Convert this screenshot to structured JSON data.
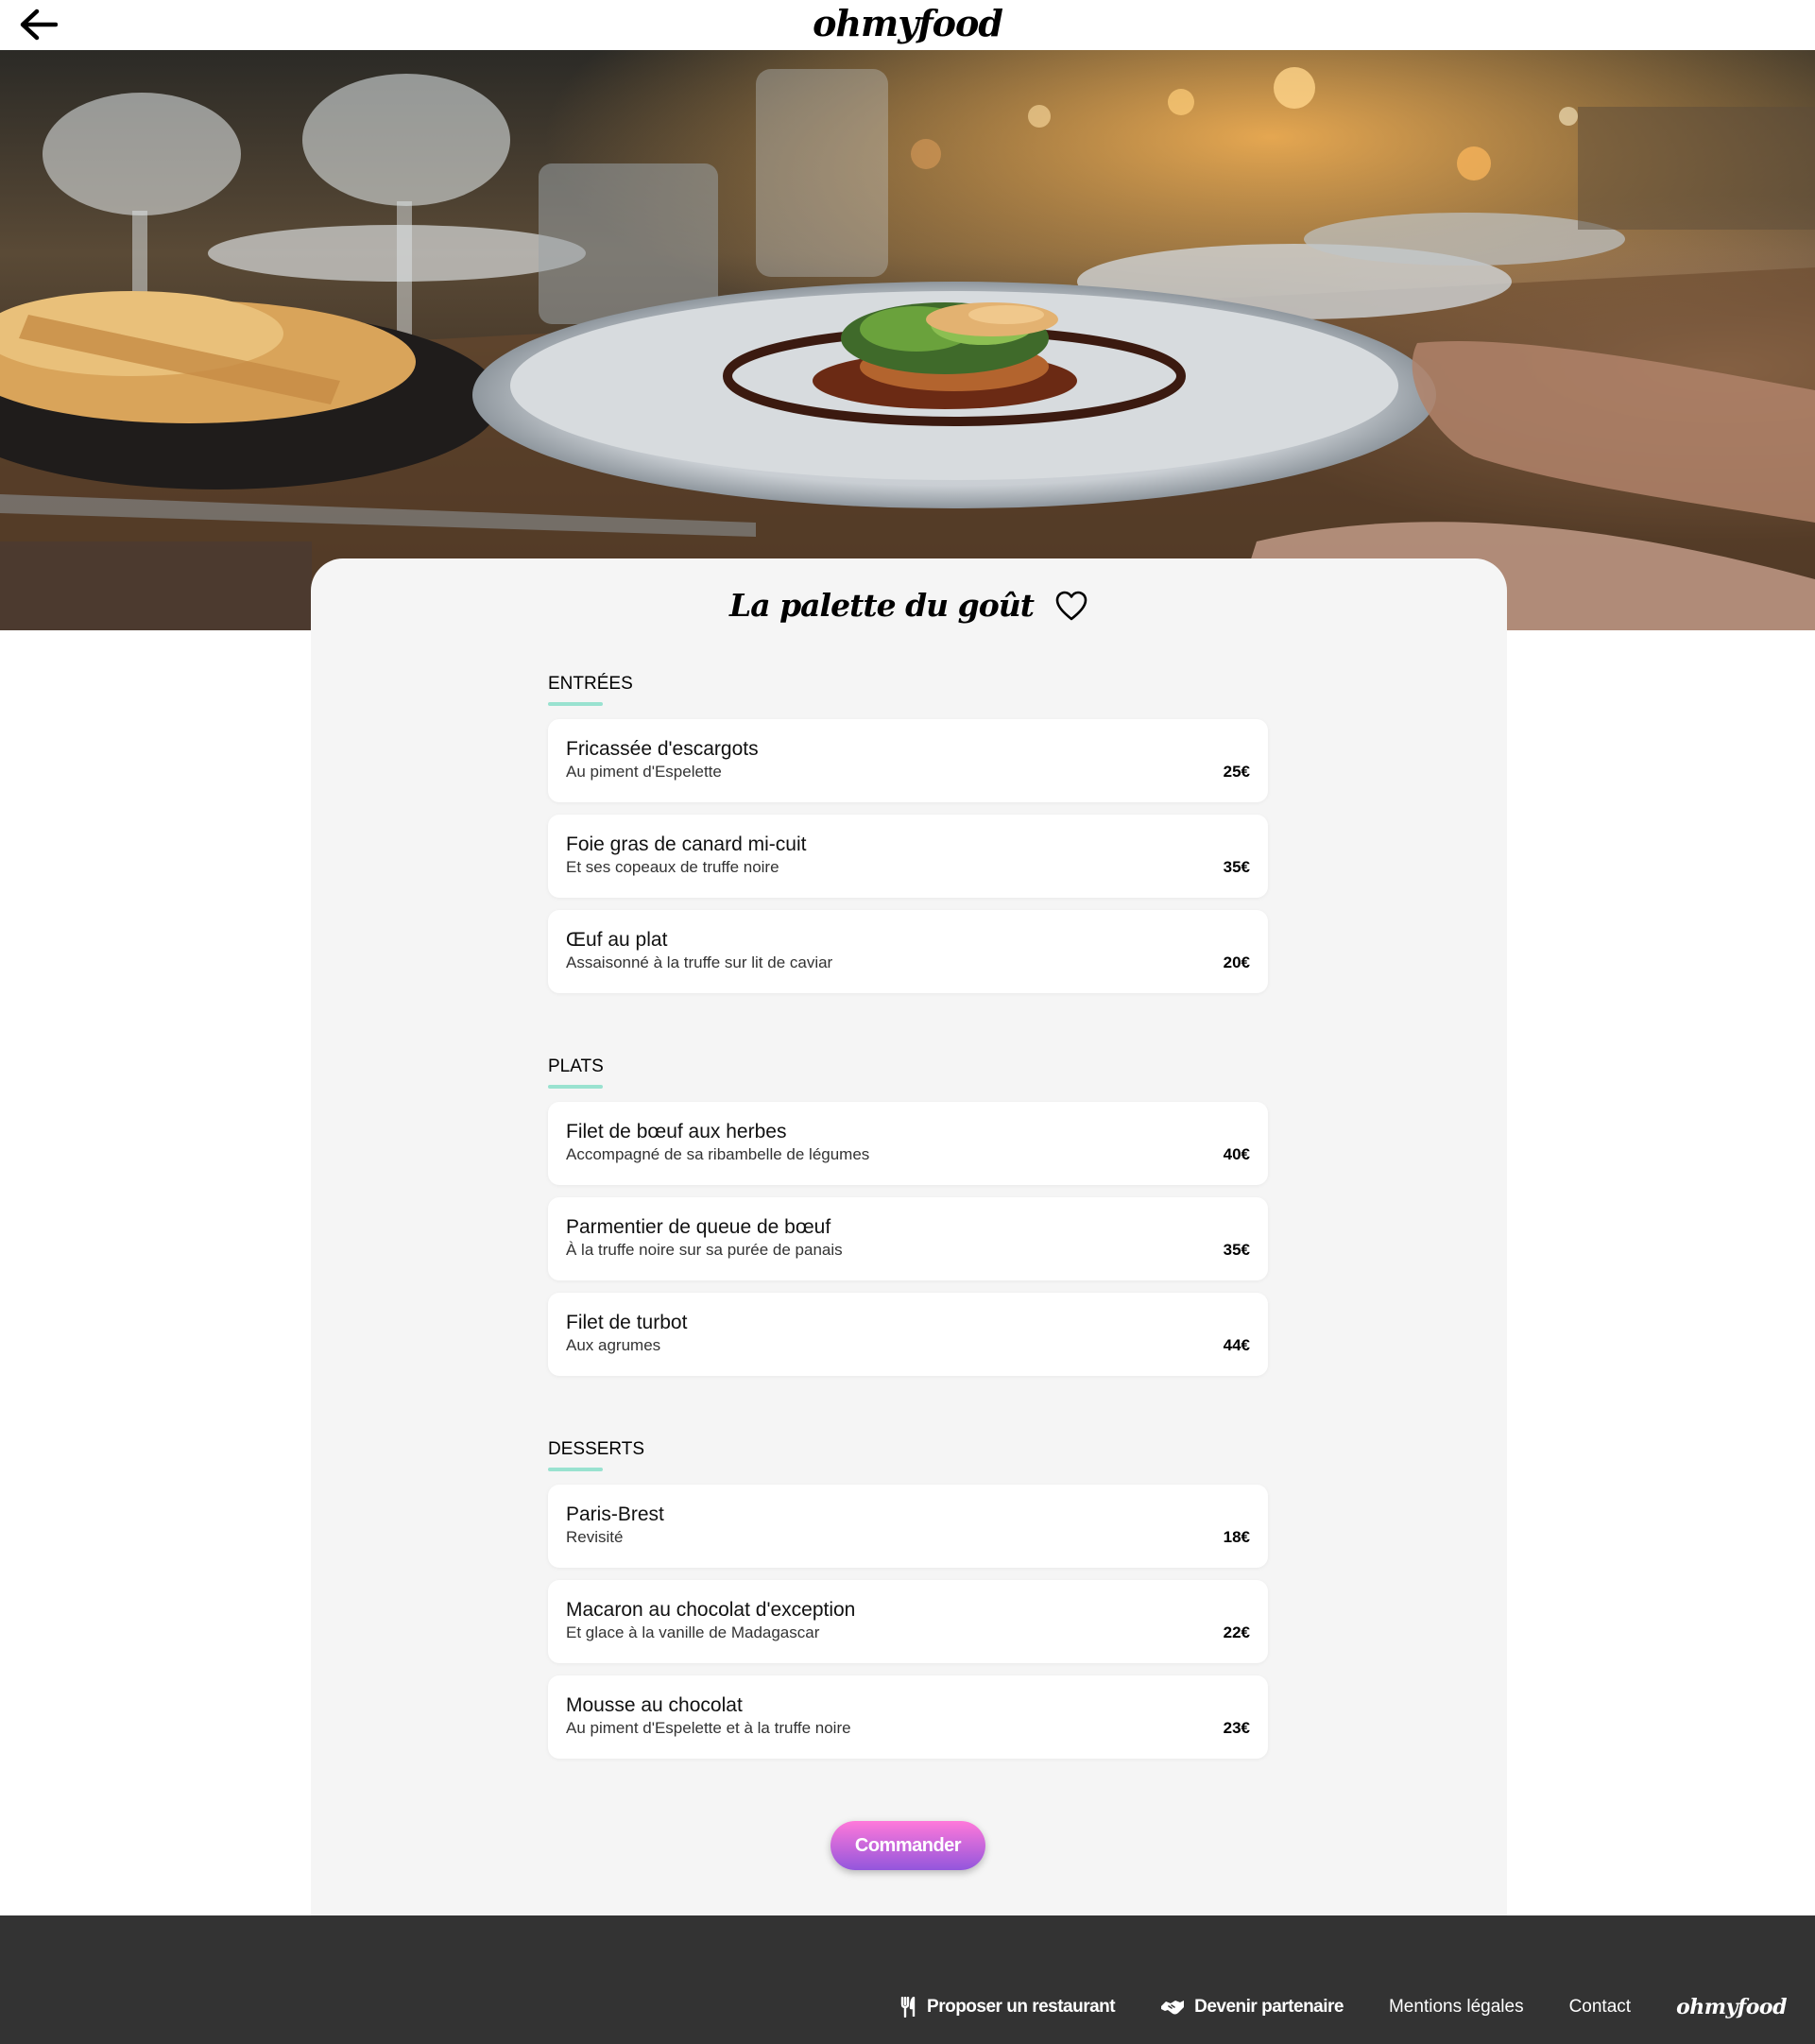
{
  "header": {
    "back_icon": "arrow-left-icon",
    "logo": "ohmyfood"
  },
  "hero": {
    "image": "restaurant-table-dish-photo"
  },
  "restaurant": {
    "name": "La palette du goût",
    "favorite_icon": "heart-outline-icon"
  },
  "menu": {
    "sections": [
      {
        "title": "ENTRÉES",
        "items": [
          {
            "name": "Fricassée d'escargots",
            "description": "Au piment d'Espelette",
            "price": "25€"
          },
          {
            "name": "Foie gras de canard mi-cuit",
            "description": "Et ses copeaux de truffe noire",
            "price": "35€"
          },
          {
            "name": "Œuf au plat",
            "description": "Assaisonné à la truffe sur lit de caviar",
            "price": "20€"
          }
        ]
      },
      {
        "title": "PLATS",
        "items": [
          {
            "name": "Filet de bœuf aux herbes",
            "description": "Accompagné de sa ribambelle de légumes",
            "price": "40€"
          },
          {
            "name": "Parmentier de queue de bœuf",
            "description": "À la truffe noire sur sa purée de panais",
            "price": "35€"
          },
          {
            "name": "Filet de turbot",
            "description": "Aux agrumes",
            "price": "44€"
          }
        ]
      },
      {
        "title": "DESSERTS",
        "items": [
          {
            "name": "Paris-Brest",
            "description": "Revisité",
            "price": "18€"
          },
          {
            "name": "Macaron au chocolat d'exception",
            "description": "Et glace à la vanille de Madagascar",
            "price": "22€"
          },
          {
            "name": "Mousse au chocolat",
            "description": "Au piment d'Espelette et à la truffe noire",
            "price": "23€"
          }
        ]
      }
    ],
    "order_button": "Commander"
  },
  "colors": {
    "section_underline": "#99e2d0",
    "button_gradient_top": "#ff79da",
    "button_gradient_bottom": "#9356dc",
    "footer_bg": "#333333",
    "card_bg": "#f5f5f5"
  },
  "footer": {
    "links": [
      {
        "label": "Proposer un restaurant",
        "icon": "utensils-icon"
      },
      {
        "label": "Devenir partenaire",
        "icon": "handshake-icon"
      },
      {
        "label": "Mentions légales"
      },
      {
        "label": "Contact"
      }
    ],
    "logo": "ohmyfood"
  }
}
